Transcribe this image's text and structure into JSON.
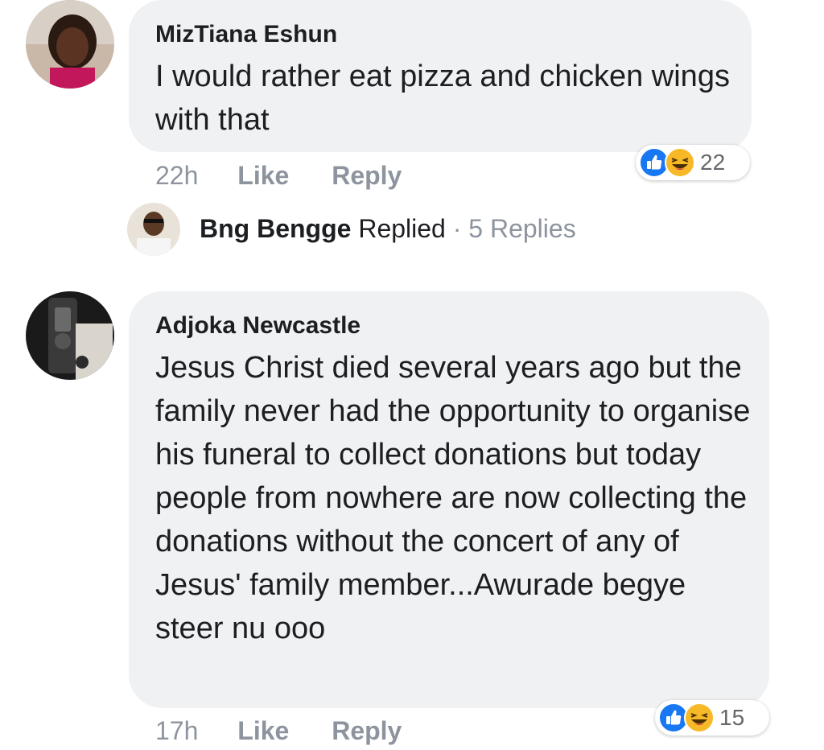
{
  "comments": [
    {
      "author": "MizTiana Eshun",
      "text": "I would rather eat pizza and chicken wings with that",
      "time": "22h",
      "like_label": "Like",
      "reply_label": "Reply",
      "reaction_count": "22",
      "reply_summary": {
        "name": "Bng Bengge",
        "action": "Replied",
        "separator": "·",
        "count_label": "5 Replies"
      }
    },
    {
      "author": "Adjoka Newcastle",
      "text": "Jesus Christ died several years ago but the family never had the opportunity to organise his funeral to collect donations but today people from nowhere are now collecting the donations without the concert of any of Jesus' family member...Awurade begye steer nu ooo",
      "time": "17h",
      "like_label": "Like",
      "reply_label": "Reply",
      "reaction_count": "15"
    }
  ],
  "icons": {
    "like_reaction": "thumbs-up-icon",
    "haha_reaction": "laughing-face-icon"
  },
  "colors": {
    "like_blue": "#1877f2",
    "haha_yellow": "#f7b928",
    "bubble_bg": "#f0f1f3",
    "meta_gray": "#8d949e"
  }
}
